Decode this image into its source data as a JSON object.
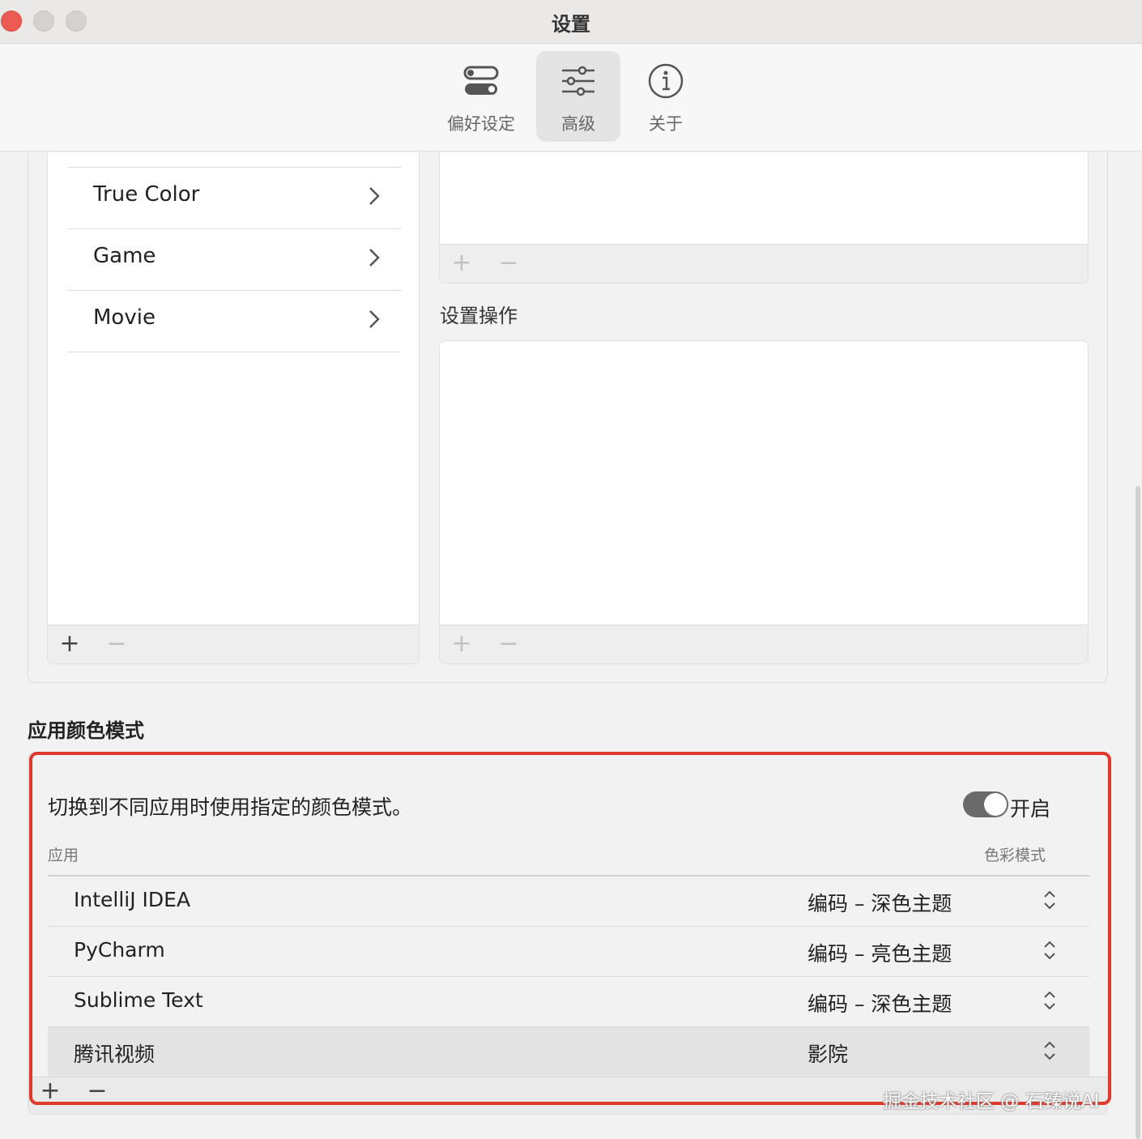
{
  "window": {
    "title": "设置"
  },
  "toolbar": {
    "tabs": [
      {
        "label": "偏好设定",
        "icon": "toggles-icon",
        "active": false
      },
      {
        "label": "高级",
        "icon": "sliders-icon",
        "active": true
      },
      {
        "label": "关于",
        "icon": "info-icon",
        "active": false
      }
    ]
  },
  "profiles": {
    "items": [
      {
        "label": "True Color"
      },
      {
        "label": "Game"
      },
      {
        "label": "Movie"
      }
    ],
    "add": "+",
    "remove": "−"
  },
  "actions": {
    "section_label": "设置操作",
    "add": "+",
    "remove": "−"
  },
  "app_color_mode": {
    "heading": "应用颜色模式",
    "description": "切换到不同应用时使用指定的颜色模式。",
    "toggle_label": "开启",
    "toggle_on": true,
    "columns": {
      "app": "应用",
      "mode": "色彩模式"
    },
    "rows": [
      {
        "app": "IntelliJ IDEA",
        "mode": "编码 – 深色主题"
      },
      {
        "app": "PyCharm",
        "mode": "编码 – 亮色主题"
      },
      {
        "app": "Sublime Text",
        "mode": "编码 – 深色主题"
      },
      {
        "app": "腾讯视频",
        "mode": "影院"
      }
    ],
    "add": "+",
    "remove": "−"
  },
  "watermark": "掘金技术社区 @ 石臻说AI",
  "colors": {
    "highlight": "#e0382d",
    "toggle_on": "#6a6a6a",
    "close": "#ec5b53"
  }
}
